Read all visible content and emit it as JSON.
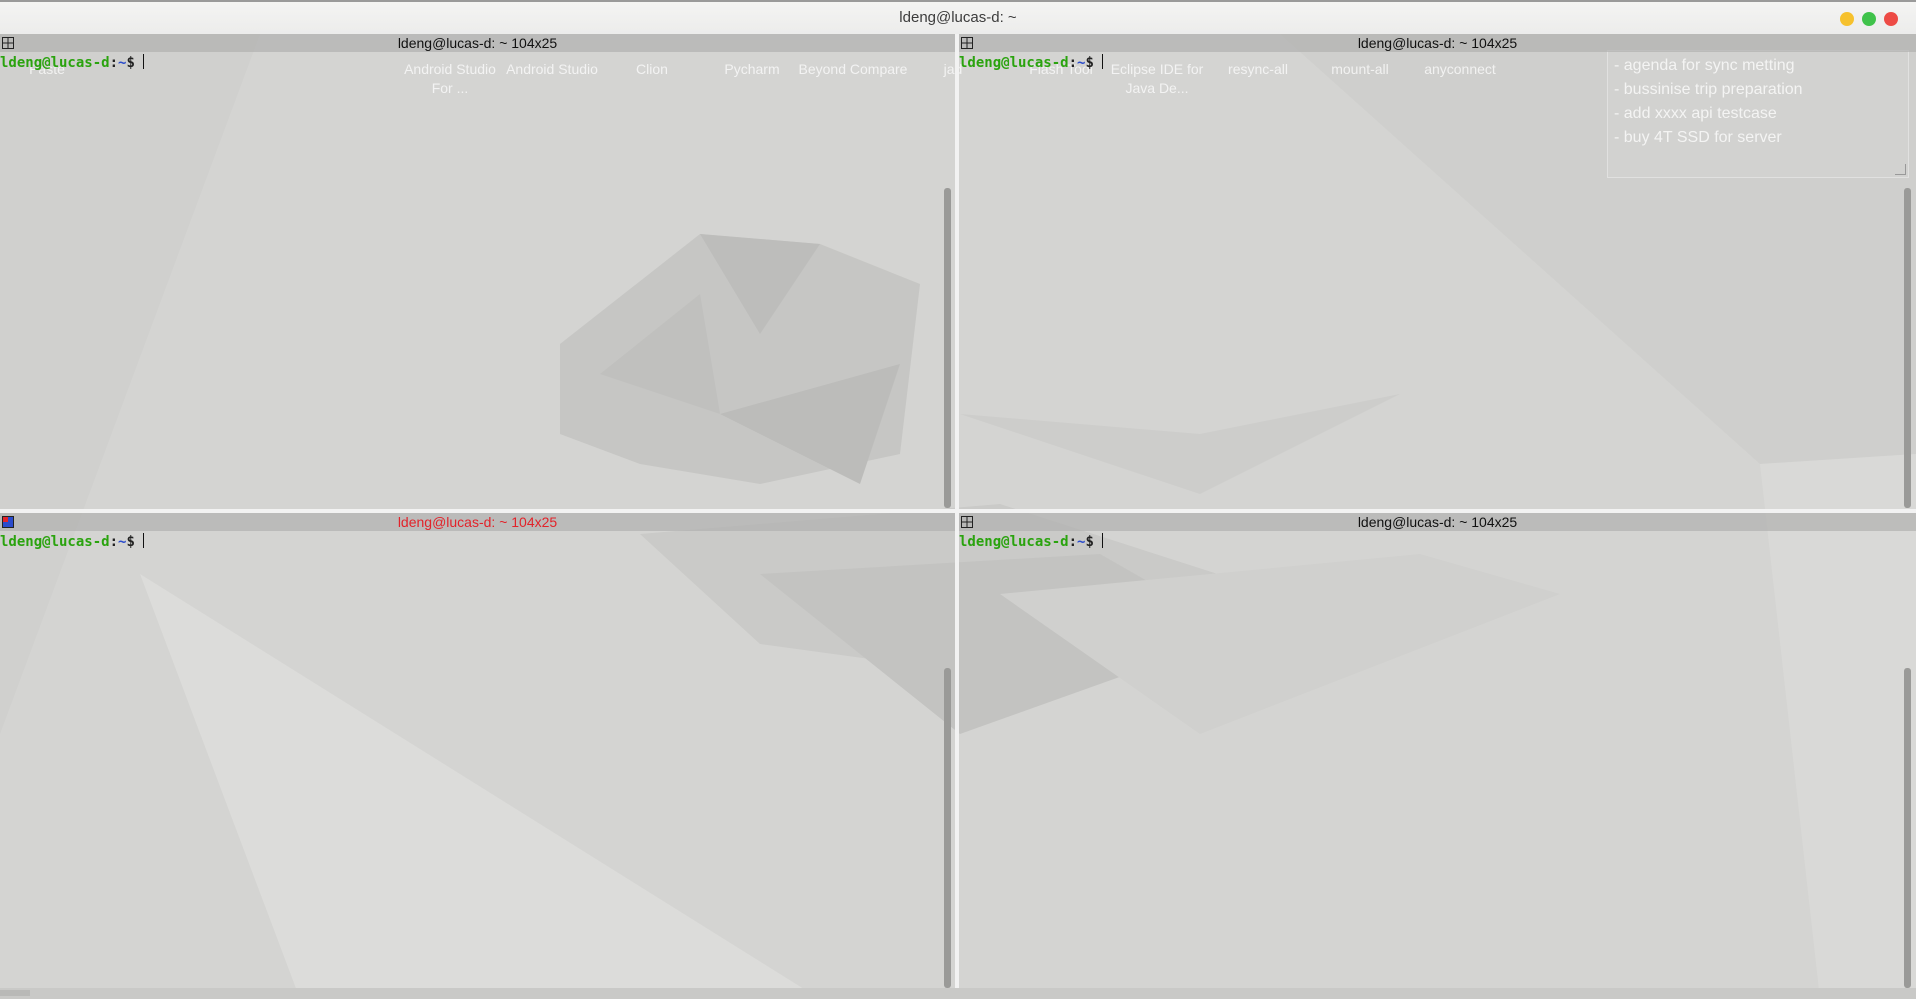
{
  "window": {
    "title": "ldeng@lucas-d: ~"
  },
  "desktop_icons": [
    {
      "label": "Paste"
    },
    {
      "label": "Android Studio For ..."
    },
    {
      "label": "Android Studio"
    },
    {
      "label": "Clion"
    },
    {
      "label": "Pycharm"
    },
    {
      "label": "Beyond Compare"
    },
    {
      "label": "jad"
    },
    {
      "label": "Flash Tool"
    },
    {
      "label": "Eclipse IDE for Java De..."
    },
    {
      "label": "resync-all"
    },
    {
      "label": "mount-all"
    },
    {
      "label": "anyconnect"
    }
  ],
  "sticky_note": {
    "lines": [
      "- agenda for sync metting",
      "- bussinise trip preparation",
      "- add xxxx api testcase",
      "- buy 4T SSD for server"
    ]
  },
  "terminals": [
    {
      "title": "ldeng@lucas-d: ~ 104x25",
      "active": false,
      "prompt_user": "ldeng@lucas-d",
      "prompt_sep": ":",
      "prompt_path": "~",
      "prompt_symbol": "$"
    },
    {
      "title": "ldeng@lucas-d: ~ 104x25",
      "active": false,
      "prompt_user": "ldeng@lucas-d",
      "prompt_sep": ":",
      "prompt_path": "~",
      "prompt_symbol": "$"
    },
    {
      "title": "ldeng@lucas-d: ~ 104x25",
      "active": true,
      "prompt_user": "ldeng@lucas-d",
      "prompt_sep": ":",
      "prompt_path": "~",
      "prompt_symbol": "$"
    },
    {
      "title": "ldeng@lucas-d: ~ 104x25",
      "active": false,
      "prompt_user": "ldeng@lucas-d",
      "prompt_sep": ":",
      "prompt_path": "~",
      "prompt_symbol": "$"
    }
  ],
  "colors": {
    "prompt_user": "#2aa30e",
    "prompt_path": "#2a4bcc",
    "active_title": "#e2232a",
    "close_button": "#ed4b45",
    "minimize_button": "#f6c12d",
    "maximize_button": "#3fc24a"
  }
}
